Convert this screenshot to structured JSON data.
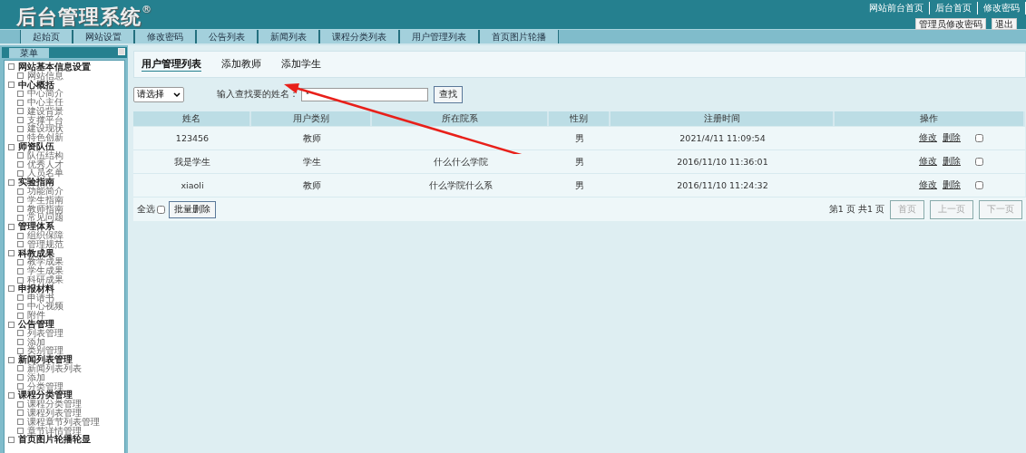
{
  "header": {
    "logo": "后台管理系统",
    "logo_mark": "®",
    "links": [
      "网站前台首页",
      "后台首页",
      "修改密码"
    ],
    "buttons": [
      "管理员修改密码",
      "退出"
    ]
  },
  "nav_tabs": [
    "起始页",
    "网站设置",
    "修改密码",
    "公告列表",
    "新闻列表",
    "课程分类列表",
    "用户管理列表",
    "首页图片轮播"
  ],
  "sidebar": {
    "title": "菜单",
    "groups": [
      {
        "label": "网站基本信息设置",
        "children": [
          "网站信息"
        ]
      },
      {
        "label": "中心概括",
        "children": [
          "中心简介",
          "中心主任",
          "建设背景",
          "支撑平台",
          "建设现状",
          "特色创新"
        ]
      },
      {
        "label": "师资队伍",
        "children": [
          "队伍结构",
          "优秀人才",
          "人员名单"
        ]
      },
      {
        "label": "实验指南",
        "children": [
          "功能简介",
          "学生指南",
          "教师指南",
          "常见问题"
        ]
      },
      {
        "label": "管理体系",
        "children": [
          "组织保障",
          "管理规范"
        ]
      },
      {
        "label": "科教成果",
        "children": [
          "教学成果",
          "学生成果",
          "科研成果"
        ]
      },
      {
        "label": "申报材料",
        "children": [
          "申请书",
          "中心视频",
          "附件"
        ]
      },
      {
        "label": "公告管理",
        "children": [
          "列表管理",
          "添加",
          "类别管理"
        ]
      },
      {
        "label": "新闻列表管理",
        "children": [
          "新闻列表列表",
          "添加",
          "分类管理"
        ]
      },
      {
        "label": "课程分类管理",
        "children": [
          "课程分类管理",
          "课程列表管理",
          "课程章节列表管理",
          "章节详情管理"
        ]
      },
      {
        "label": "首页图片轮播轮显"
      }
    ]
  },
  "page_tabs": [
    {
      "label": "用户管理列表",
      "selected": true
    },
    {
      "label": "添加教师",
      "selected": false
    },
    {
      "label": "添加学生",
      "selected": false
    }
  ],
  "search": {
    "select": "请选择",
    "label": "输入查找要的姓名：",
    "value": "*",
    "button": "查找"
  },
  "table": {
    "columns": [
      "姓名",
      "用户类别",
      "所在院系",
      "性别",
      "注册时间",
      "操作"
    ],
    "rows": [
      {
        "cells": [
          "123456",
          "教师",
          "",
          "男",
          "2021/4/11 11:09:54"
        ],
        "actions": [
          "修改",
          "删除"
        ],
        "checked": false
      },
      {
        "cells": [
          "我是学生",
          "学生",
          "什么什么学院",
          "男",
          "2016/11/10 11:36:01"
        ],
        "actions": [
          "修改",
          "删除"
        ],
        "checked": false
      },
      {
        "cells": [
          "xiaoli",
          "教师",
          "什么学院什么系",
          "男",
          "2016/11/10 11:24:32"
        ],
        "actions": [
          "修改",
          "删除"
        ],
        "checked": false
      }
    ]
  },
  "footer": {
    "select_all": "全选",
    "select_all_checked": false,
    "batch_delete": "批量删除",
    "page_info": "第1 页 共1 页",
    "pager": [
      {
        "label": "首页",
        "disabled": true
      },
      {
        "label": "上一页",
        "disabled": true
      },
      {
        "label": "下一页",
        "disabled": true
      }
    ]
  }
}
